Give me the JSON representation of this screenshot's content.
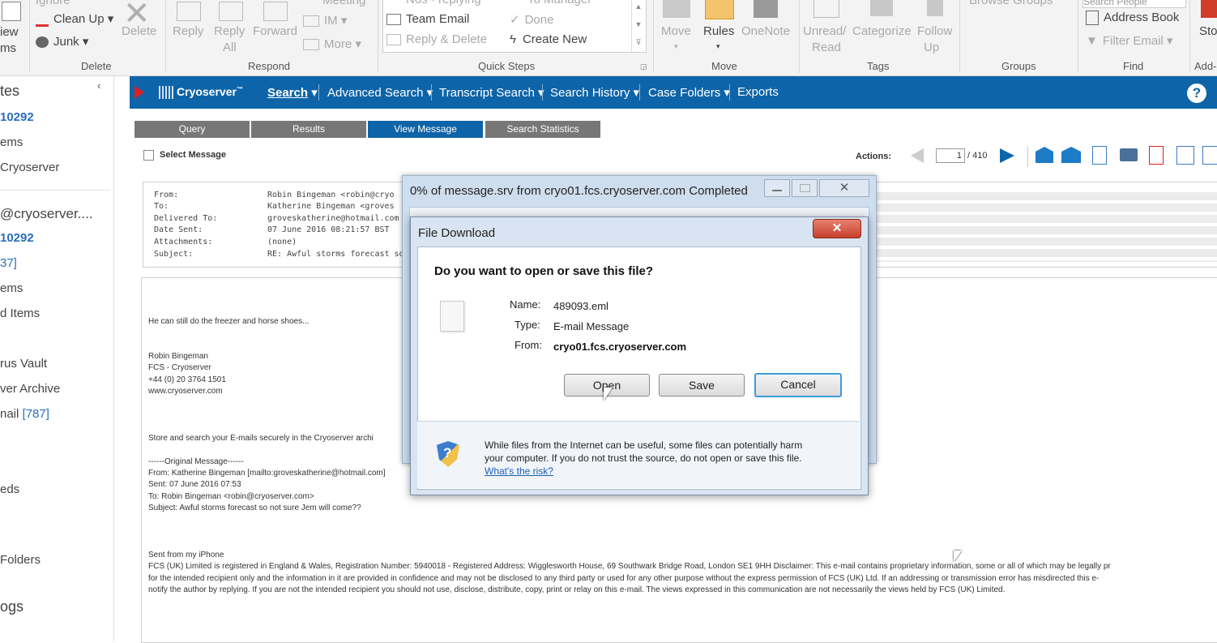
{
  "ribbon": {
    "view_top": "iew",
    "view_bot": "ms",
    "ignore": "Ignore",
    "cleanup": "Clean Up",
    "junk": "Junk",
    "delete": "Delete",
    "reply": "Reply",
    "reply_all_1": "Reply",
    "reply_all_2": "All",
    "forward": "Forward",
    "meeting": "Meeting",
    "im": "IM",
    "more": "More",
    "qs_top1": "Nos - replying",
    "qs_top2": "To Manager",
    "team_email": "Team Email",
    "done": "Done",
    "reply_delete": "Reply & Delete",
    "create_new": "Create New",
    "move": "Move",
    "rules": "Rules",
    "onenote": "OneNote",
    "unread_1": "Unread/",
    "unread_2": "Read",
    "categorize": "Categorize",
    "follow_1": "Follow",
    "follow_2": "Up",
    "browse_groups": "Browse Groups",
    "search_people": "Search People",
    "address_book": "Address Book",
    "filter_email": "Filter Email",
    "store": "Sto",
    "groups": {
      "delete": "Delete",
      "respond": "Respond",
      "quick_steps": "Quick Steps",
      "move": "Move",
      "tags": "Tags",
      "groups": "Groups",
      "find": "Find",
      "addins": "Add-"
    }
  },
  "folders": [
    {
      "text": "tes",
      "count": ""
    },
    {
      "text": "10292",
      "count": ""
    },
    {
      "text": "ems",
      "count": ""
    },
    {
      "text": "Cryoserver",
      "count": ""
    },
    {
      "text": "@cryoserver....",
      "count": ""
    },
    {
      "text": "10292",
      "count": ""
    },
    {
      "text": "",
      "count": "37]"
    },
    {
      "text": "ems",
      "count": ""
    },
    {
      "text": "d Items",
      "count": ""
    },
    {
      "text": "rus Vault",
      "count": ""
    },
    {
      "text": "ver Archive",
      "count": ""
    },
    {
      "text": "nail ",
      "count": "[787]"
    },
    {
      "text": "eds",
      "count": ""
    },
    {
      "text": "Folders",
      "count": ""
    },
    {
      "text": "ogs",
      "count": ""
    }
  ],
  "cryo": {
    "logo": "Cryoserver",
    "nav": [
      "Search",
      "Advanced Search",
      "Transcript Search",
      "Search History",
      "Case Folders",
      "Exports"
    ],
    "tabs": [
      "Query",
      "Results",
      "View Message",
      "Search Statistics"
    ],
    "select_message": "Select Message",
    "actions_label": "Actions:",
    "page_current": "1",
    "page_total": "/ 410"
  },
  "header": {
    "labels": [
      "From:",
      "To:",
      "Delivered To:",
      "Date Sent:",
      "Attachments:",
      "Subject:"
    ],
    "values": [
      "Robin Bingeman <robin@cryo",
      "Katherine Bingeman <groves",
      "groveskatherine@hotmail.com",
      "07 June 2016 08:21:57 BST",
      "(none)",
      "RE: Awful storms forecast so"
    ]
  },
  "body_lines": [
    "He can still do the freezer and horse shoes...",
    "Robin Bingeman",
    "FCS - Cryoserver",
    "+44 (0) 20 3764 1501",
    "www.cryoserver.com",
    "Store and search your E-mails securely in the Cryoserver archi",
    "------Original Message------",
    "From: Katherine Bingeman [mailto:groveskatherine@hotmail.com]",
    "Sent: 07 June 2016 07:53",
    "To: Robin Bingeman <robin@cryoserver.com>",
    "Subject: Awful storms forecast so not sure Jem will come??",
    "Sent from my iPhone",
    "FCS (UK) Limited is registered in England & Wales, Registration Number: 5940018 - Registered Address: Wigglesworth House, 69 Southwark Bridge Road, London SE1 9HH Disclaimer: This e-mail contains proprietary information, some or all of which may be legally pr",
    "for the intended recipient only and the information in it are provided in confidence and may not be disclosed to any third party or used for any other purpose without the express permission of FCS (UK) Ltd. If an addressing or transmission error has misdirected this e-",
    "notify the author by replying. If you are not the intended recipient you should not use, disclose, distribute, copy, print or relay on this e-mail. The views expressed in this communication are not necessarily the views held by FCS (UK) Limited."
  ],
  "progress_dialog": {
    "title": "0% of message.srv from cryo01.fcs.cryoserver.com Completed"
  },
  "file_dialog": {
    "title": "File Download",
    "question": "Do you want to open or save this file?",
    "name_label": "Name:",
    "name_value": "489093.eml",
    "type_label": "Type:",
    "type_value": "E-mail Message",
    "from_label": "From:",
    "from_value": "cryo01.fcs.cryoserver.com",
    "open": "Open",
    "save": "Save",
    "cancel": "Cancel",
    "warning_1": "While files from the Internet can be useful, some files can potentially harm",
    "warning_2": "your computer. If you do not trust the source, do not open or save this file.",
    "risk_link": "What's the risk?"
  },
  "colors": {
    "cryo_blue": "#0e64a8",
    "link_blue": "#2a6ebb",
    "tab_grey": "#777777"
  }
}
